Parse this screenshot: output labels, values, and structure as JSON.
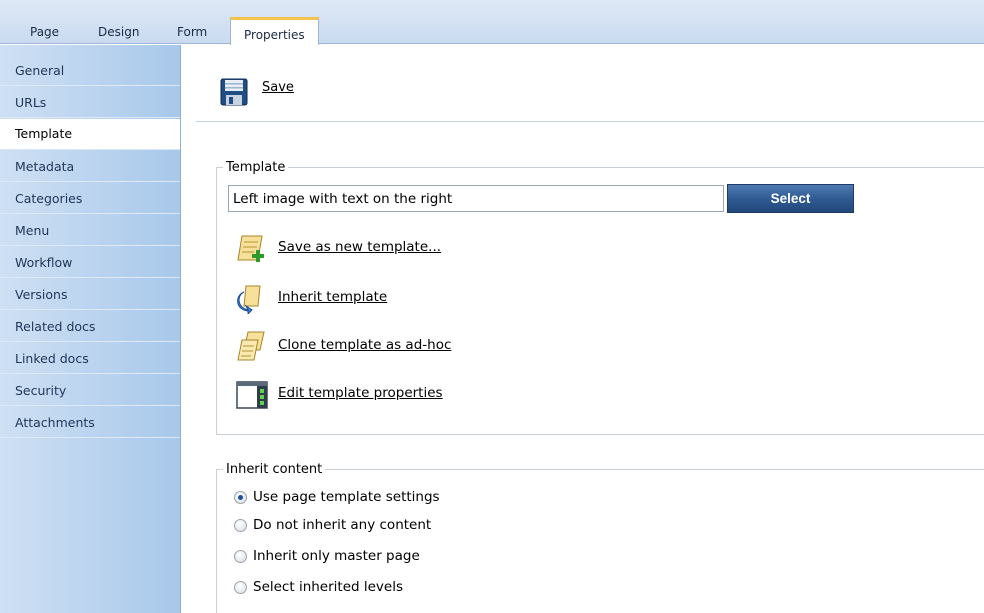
{
  "tabs": [
    {
      "label": "Page",
      "active": false
    },
    {
      "label": "Design",
      "active": false
    },
    {
      "label": "Form",
      "active": false
    },
    {
      "label": "Properties",
      "active": true
    }
  ],
  "sidebar": {
    "items": [
      {
        "label": "General",
        "selected": false
      },
      {
        "label": "URLs",
        "selected": false
      },
      {
        "label": "Template",
        "selected": true
      },
      {
        "label": "Metadata",
        "selected": false
      },
      {
        "label": "Categories",
        "selected": false
      },
      {
        "label": "Menu",
        "selected": false
      },
      {
        "label": "Workflow",
        "selected": false
      },
      {
        "label": "Versions",
        "selected": false
      },
      {
        "label": "Related docs",
        "selected": false
      },
      {
        "label": "Linked docs",
        "selected": false
      },
      {
        "label": "Security",
        "selected": false
      },
      {
        "label": "Attachments",
        "selected": false
      }
    ]
  },
  "toolbar": {
    "save_label": "Save",
    "save_icon": "floppy-disk-icon"
  },
  "template_section": {
    "legend": "Template",
    "value": "Left image with text on the right",
    "select_label": "Select",
    "actions": [
      {
        "label": "Save as new template...",
        "icon": "save-template-icon"
      },
      {
        "label": "Inherit template",
        "icon": "inherit-template-icon"
      },
      {
        "label": "Clone template as ad-hoc",
        "icon": "clone-template-icon"
      },
      {
        "label": "Edit template properties",
        "icon": "edit-properties-icon"
      }
    ]
  },
  "inherit_section": {
    "legend": "Inherit content",
    "options": [
      {
        "label": "Use page template settings",
        "checked": true
      },
      {
        "label": "Do not inherit any content",
        "checked": false
      },
      {
        "label": "Inherit only master page",
        "checked": false
      },
      {
        "label": "Select inherited levels",
        "checked": false
      }
    ]
  },
  "colors": {
    "accent_tab": "#f3c34b",
    "sidebar_bg": "#a8c8ea",
    "select_button": "#2d5990"
  }
}
